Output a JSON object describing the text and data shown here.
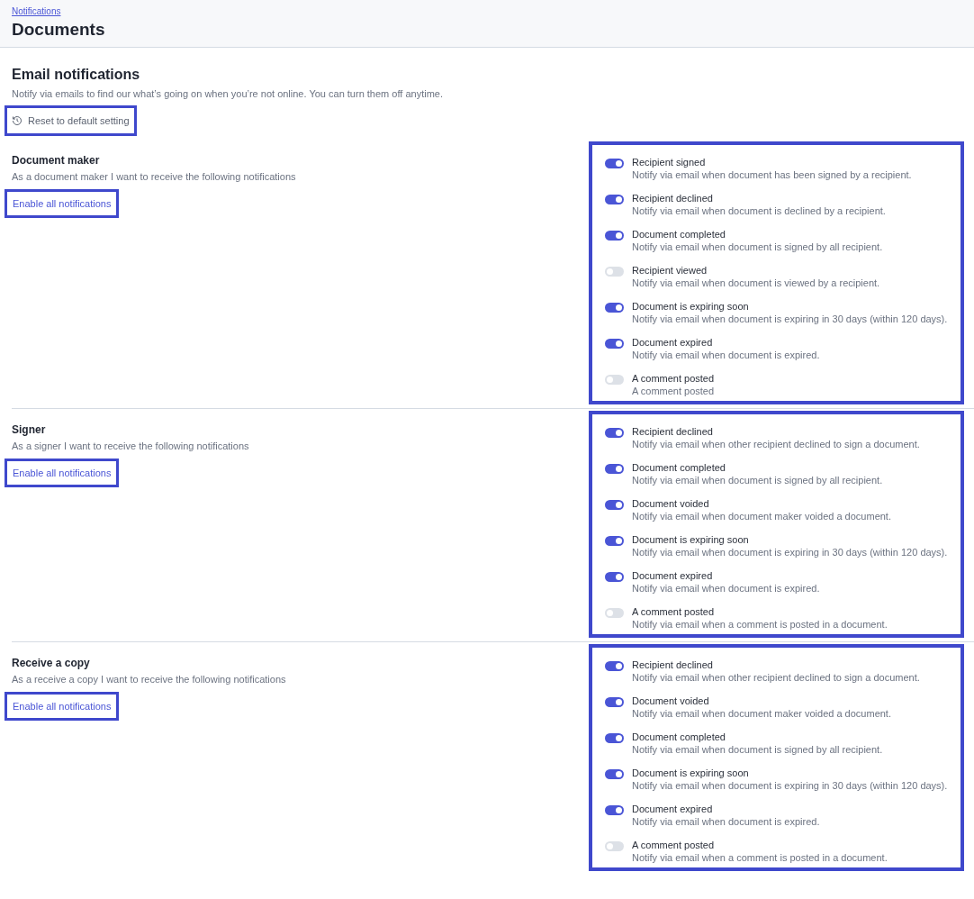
{
  "breadcrumb": "Notifications",
  "title": "Documents",
  "email": {
    "heading": "Email notifications",
    "description": "Notify via emails to find our what’s going on when you’re not online. You can turn them off anytime.",
    "reset_button": "Reset to default setting"
  },
  "sections": [
    {
      "title": "Document maker",
      "subtitle": "As a document maker I want to receive the following notifications",
      "enable_all": "Enable all notifications",
      "items": [
        {
          "label": "Recipient signed",
          "description": "Notify via email when document has been signed by a recipient.",
          "on": true
        },
        {
          "label": "Recipient declined",
          "description": "Notify via email when document is declined by a recipient.",
          "on": true
        },
        {
          "label": "Document completed",
          "description": "Notify via email when document is signed by all recipient.",
          "on": true
        },
        {
          "label": "Recipient viewed",
          "description": "Notify via email when document is viewed by a recipient.",
          "on": false
        },
        {
          "label": "Document is expiring soon",
          "description": "Notify via email when document is expiring in 30 days (within 120 days).",
          "on": true
        },
        {
          "label": "Document expired",
          "description": "Notify via email when document is expired.",
          "on": true
        },
        {
          "label": "A comment posted",
          "description": "A comment posted",
          "on": false
        }
      ]
    },
    {
      "title": "Signer",
      "subtitle": "As a signer I want to receive the following notifications",
      "enable_all": "Enable all notifications",
      "items": [
        {
          "label": "Recipient declined",
          "description": "Notify via email when other recipient declined to sign a document.",
          "on": true
        },
        {
          "label": "Document completed",
          "description": "Notify via email when document is signed by all recipient.",
          "on": true
        },
        {
          "label": "Document voided",
          "description": "Notify via email when document maker voided a document.",
          "on": true
        },
        {
          "label": "Document is expiring soon",
          "description": "Notify via email when document is expiring in 30 days (within 120 days).",
          "on": true
        },
        {
          "label": "Document expired",
          "description": "Notify via email when document is expired.",
          "on": true
        },
        {
          "label": "A comment posted",
          "description": "Notify via email when a comment is posted in a document.",
          "on": false
        }
      ]
    },
    {
      "title": "Receive a copy",
      "subtitle": "As a receive a copy I want to receive the following notifications",
      "enable_all": "Enable all notifications",
      "items": [
        {
          "label": "Recipient declined",
          "description": "Notify via email when other recipient declined to sign a document.",
          "on": true
        },
        {
          "label": "Document voided",
          "description": "Notify via email when document maker voided a document.",
          "on": true
        },
        {
          "label": "Document completed",
          "description": "Notify via email when document is signed by all recipient.",
          "on": true
        },
        {
          "label": "Document is expiring soon",
          "description": "Notify via email when document is expiring in 30 days (within 120 days).",
          "on": true
        },
        {
          "label": "Document expired",
          "description": "Notify via email when document is expired.",
          "on": true
        },
        {
          "label": "A comment posted",
          "description": "Notify via email when a comment is posted in a document.",
          "on": false
        }
      ]
    }
  ]
}
